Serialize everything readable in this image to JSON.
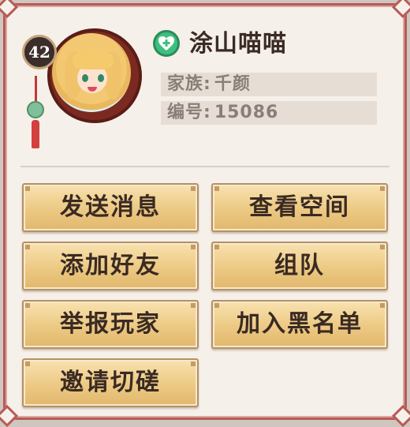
{
  "player": {
    "level": "42",
    "name": "涂山喵喵",
    "clan_label": "家族:",
    "clan_value": "千颜",
    "id_label": "编号:",
    "id_value": "15086",
    "status_icon": "health-cross-heart-icon"
  },
  "actions": {
    "send_message": "发送消息",
    "view_space": "查看空间",
    "add_friend": "添加好友",
    "team_up": "组队",
    "report_player": "举报玩家",
    "add_blacklist": "加入黑名单",
    "invite_duel": "邀请切磋"
  },
  "colors": {
    "frame": "#b85a55",
    "button": "#ecc983",
    "status_icon": "#3fbf7f"
  }
}
